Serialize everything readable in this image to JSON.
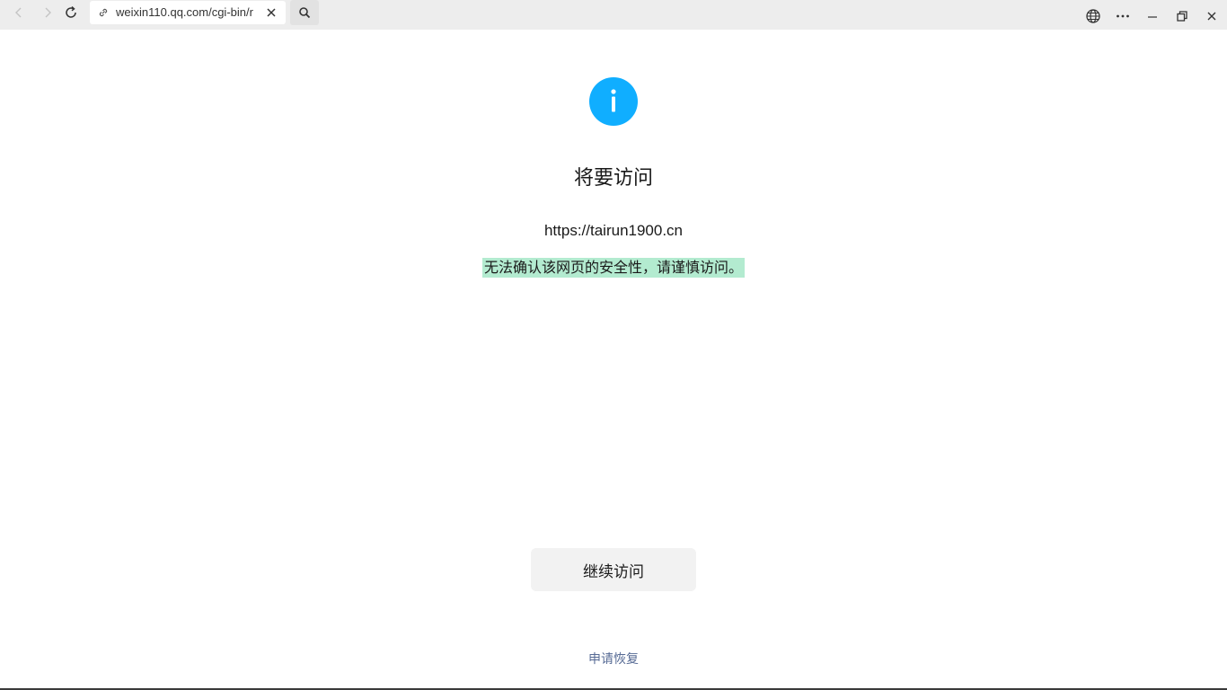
{
  "browser": {
    "address_url": "weixin110.qq.com/cgi-bin/r",
    "icons": {
      "back": "chevron-left-icon",
      "forward": "chevron-right-icon",
      "refresh": "refresh-icon",
      "link": "link-icon",
      "close_tab": "close-icon",
      "search": "search-icon",
      "globe": "globe-icon",
      "more": "more-icon",
      "minimize": "minimize-icon",
      "restore": "restore-icon",
      "close_window": "close-icon"
    }
  },
  "page": {
    "info_icon": "info-icon",
    "title": "将要访问",
    "target_url": "https://tairun1900.cn",
    "warning": "无法确认该网页的安全性，请谨慎访问。",
    "continue_label": "继续访问",
    "recover_label": "申请恢复"
  },
  "colors": {
    "accent": "#10aeff",
    "warning_highlight": "#b3ebd0",
    "link": "#576b95"
  }
}
